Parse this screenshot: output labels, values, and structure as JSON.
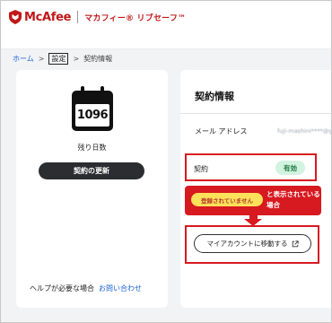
{
  "header": {
    "brand": "McAfee",
    "product": "マカフィー® リブセーフ™"
  },
  "breadcrumb": {
    "home": "ホーム",
    "separator": ">",
    "settings": "設定",
    "current": "契約情報"
  },
  "summary": {
    "days_remaining": "1096",
    "days_label": "残り日数",
    "renew_label": "契約の更新",
    "help_text": "ヘルプが必要な場合",
    "help_link": "お問い合わせ"
  },
  "contract": {
    "title": "契約情報",
    "email_label": "メール アドレス",
    "email_value": "fuji-mashini****@gm",
    "contract_label": "契約",
    "status": "有効",
    "account_button": "マイアカウントに移動する"
  },
  "callout": {
    "badge": "登録されていません",
    "text": "と表示されている場合"
  },
  "colors": {
    "brand_red": "#c01818",
    "highlight_red": "#d71920",
    "link_blue": "#1a62d6",
    "status_green_bg": "#d2f3df",
    "status_green_text": "#1c7a45",
    "badge_yellow": "#fde15a"
  },
  "icons": {
    "logo": "mcafee-shield-icon",
    "calendar": "calendar-icon",
    "external_link": "external-link-icon",
    "arrow": "arrow-down-icon"
  }
}
